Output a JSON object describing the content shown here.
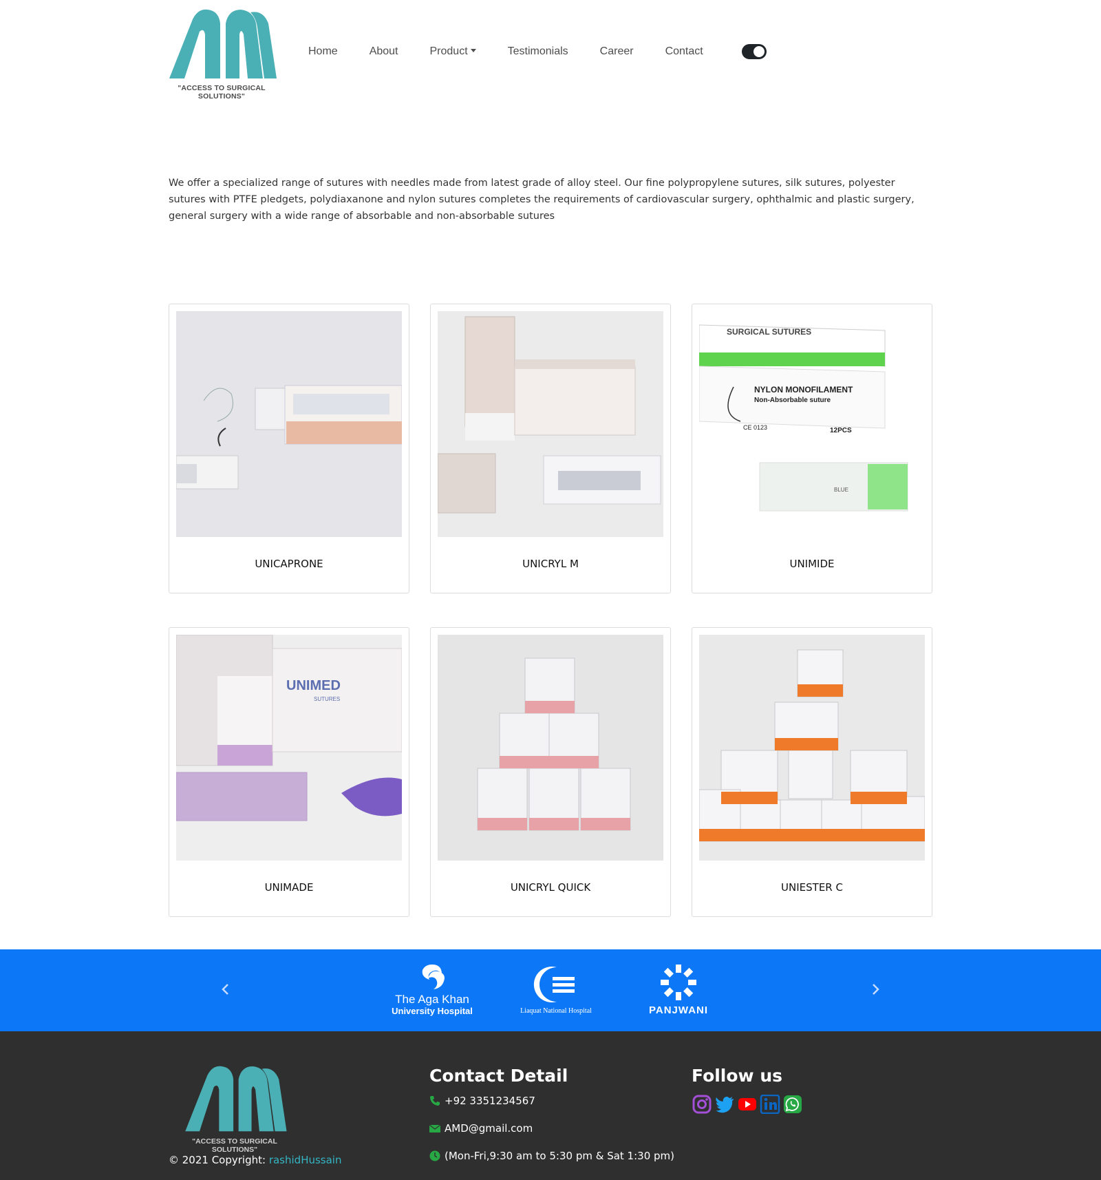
{
  "brand": {
    "tagline": "\"ACCESS TO SURGICAL SOLUTIONS\"",
    "primary_color": "#4ab0b5",
    "accent_color": "#0d78f7"
  },
  "nav": {
    "items": [
      {
        "label": "Home"
      },
      {
        "label": "About"
      },
      {
        "label": "Product",
        "has_dropdown": true
      },
      {
        "label": "Testimonials"
      },
      {
        "label": "Career"
      },
      {
        "label": "Contact"
      }
    ],
    "theme_toggle": "on"
  },
  "intro": {
    "text": "We offer a specialized range of sutures with needles made from latest grade of alloy steel. Our fine polypropylene sutures, silk sutures, polyester sutures with PTFE pledgets, polydiaxanone and nylon sutures completes the requirements of cardiovascular surgery, ophthalmic and plastic surgery, general surgery with a wide range of absorbable and non-absorbable sutures"
  },
  "products": [
    {
      "name": "UNICAPRONE",
      "image": "suture-pack-photo"
    },
    {
      "name": "UNICRYL M",
      "image": "suture-boxes-photo"
    },
    {
      "name": "UNIMIDE",
      "image": "nylon-monofilament-box-photo",
      "box_text": {
        "header": "SURGICAL SUTURES",
        "title": "NYLON MONOFILAMENT",
        "subtitle": "Non-Absorbable suture",
        "count": "12PCS",
        "ce": "CE 0123",
        "color": "BLUE"
      }
    },
    {
      "name": "UNIMADE",
      "image": "unimed-sutures-box-photo",
      "box_text": {
        "brand": "UNIMED",
        "sub": "SUTURES"
      }
    },
    {
      "name": "UNICRYL QUICK",
      "image": "pink-box-pyramid-photo"
    },
    {
      "name": "UNIESTER C",
      "image": "orange-box-pyramid-photo"
    }
  ],
  "partners": {
    "logos": [
      {
        "line1": "The Aga Khan",
        "line2": "University Hospital"
      },
      {
        "line1": "Liaquat National Hospital"
      },
      {
        "line1": "PANJWANI"
      }
    ],
    "prev_icon": "chevron-left-icon",
    "next_icon": "chevron-right-icon"
  },
  "footer": {
    "tagline": "\"ACCESS TO SURGICAL SOLUTIONS\"",
    "copyright_prefix": "© 2021 Copyright: ",
    "copyright_author": "rashidHussain",
    "contact_title": "Contact Detail",
    "phone": "+92 3351234567",
    "email": "AMD@gmail.com",
    "hours": "(Mon-Fri,9:30 am to 5:30 pm & Sat 1:30 pm)",
    "follow_title": "Follow us",
    "socials": [
      "instagram-icon",
      "twitter-icon",
      "youtube-icon",
      "linkedin-icon",
      "whatsapp-icon"
    ],
    "contact_icon_color": "#28a745"
  }
}
